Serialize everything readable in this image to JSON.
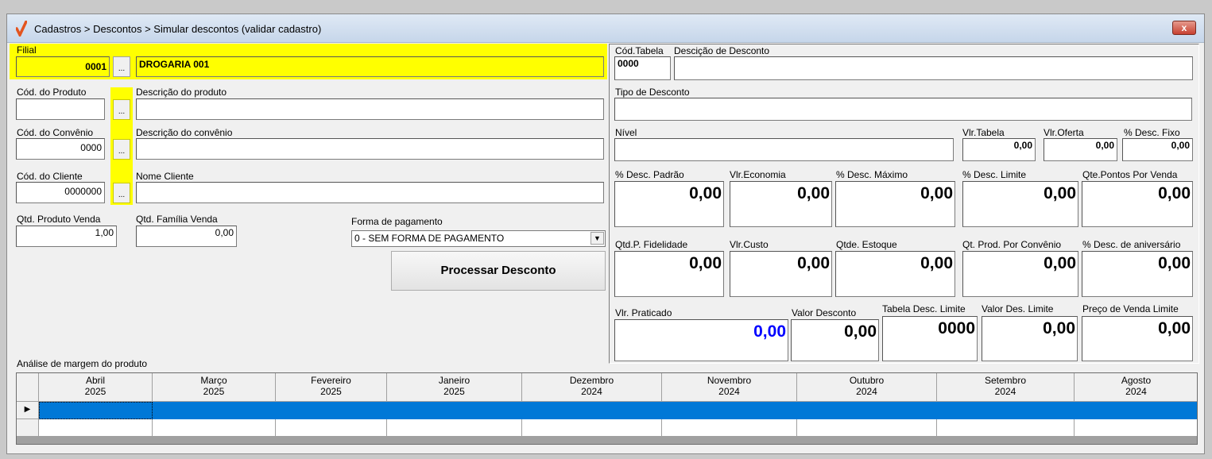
{
  "window": {
    "title": "Cadastros > Descontos > Simular descontos (validar cadastro)",
    "close_label": "x"
  },
  "left": {
    "filial": {
      "label": "Filial",
      "code": "0001",
      "name": "DROGARIA 001",
      "browse": "..."
    },
    "produto": {
      "code_label": "Cód. do Produto",
      "desc_label": "Descrição  do produto",
      "code": "",
      "desc": "",
      "browse": "..."
    },
    "convenio": {
      "code_label": "Cód. do Convênio",
      "desc_label": "Descrição  do convênio",
      "code": "0000",
      "desc": "",
      "browse": "..."
    },
    "cliente": {
      "code_label": "Cód. do Cliente",
      "desc_label": "Nome Cliente",
      "code": "0000000",
      "desc": "",
      "browse": "..."
    },
    "qtd_produto_label": "Qtd. Produto Venda",
    "qtd_produto": "1,00",
    "qtd_familia_label": "Qtd. Família Venda",
    "qtd_familia": "0,00",
    "pagamento_label": "Forma de pagamento",
    "pagamento_value": "0 - SEM FORMA DE PAGAMENTO",
    "processar_label": "Processar Desconto"
  },
  "right": {
    "cod_tabela_label": "Cód.Tabela",
    "cod_tabela": "0000",
    "descricao_label": "Descição de Desconto",
    "descricao": "",
    "tipo_label": "Tipo de Desconto",
    "tipo": "",
    "nivel_label": "Nível",
    "nivel": "",
    "vlr_tabela_label": "Vlr.Tabela",
    "vlr_tabela": "0,00",
    "vlr_oferta_label": "Vlr.Oferta",
    "vlr_oferta": "0,00",
    "desc_fixo_label": "% Desc. Fixo",
    "desc_fixo": "0,00",
    "row1": [
      {
        "label": "% Desc. Padrão",
        "value": "0,00"
      },
      {
        "label": "Vlr.Economia",
        "value": "0,00"
      },
      {
        "label": "% Desc. Máximo",
        "value": "0,00"
      },
      {
        "label": "% Desc. Limite",
        "value": "0,00"
      },
      {
        "label": "Qte.Pontos Por Venda",
        "value": "0,00"
      }
    ],
    "row2": [
      {
        "label": "Qtd.P. Fidelidade",
        "value": "0,00"
      },
      {
        "label": "Vlr.Custo",
        "value": "0,00"
      },
      {
        "label": "Qtde. Estoque",
        "value": "0,00"
      },
      {
        "label": "Qt. Prod. Por Convênio",
        "value": "0,00"
      },
      {
        "label": "% Desc. de aniversário",
        "value": "0,00"
      }
    ],
    "row3": [
      {
        "label": "Vlr. Praticado",
        "value": "0,00"
      },
      {
        "label": "Valor Desconto",
        "value": "0,00"
      },
      {
        "label": "Tabela Desc. Limite",
        "value": "0000"
      },
      {
        "label": "Valor Des. Limite",
        "value": "0,00"
      },
      {
        "label": "Preço de Venda Limite",
        "value": "0,00"
      }
    ]
  },
  "grid": {
    "title": "Análise de margem do produto",
    "columns": [
      {
        "month": "Abril",
        "year": "2025"
      },
      {
        "month": "Março",
        "year": "2025"
      },
      {
        "month": "Fevereiro",
        "year": "2025"
      },
      {
        "month": "Janeiro",
        "year": "2025"
      },
      {
        "month": "Dezembro",
        "year": "2024"
      },
      {
        "month": "Novembro",
        "year": "2024"
      },
      {
        "month": "Outubro",
        "year": "2024"
      },
      {
        "month": "Setembro",
        "year": "2024"
      },
      {
        "month": "Agosto",
        "year": "2024"
      }
    ],
    "row_indicator": "▶"
  },
  "colors": {
    "highlight_yellow": "#ffff00",
    "selection_blue": "#0078d7",
    "praticado_blue": "#0000ff"
  }
}
